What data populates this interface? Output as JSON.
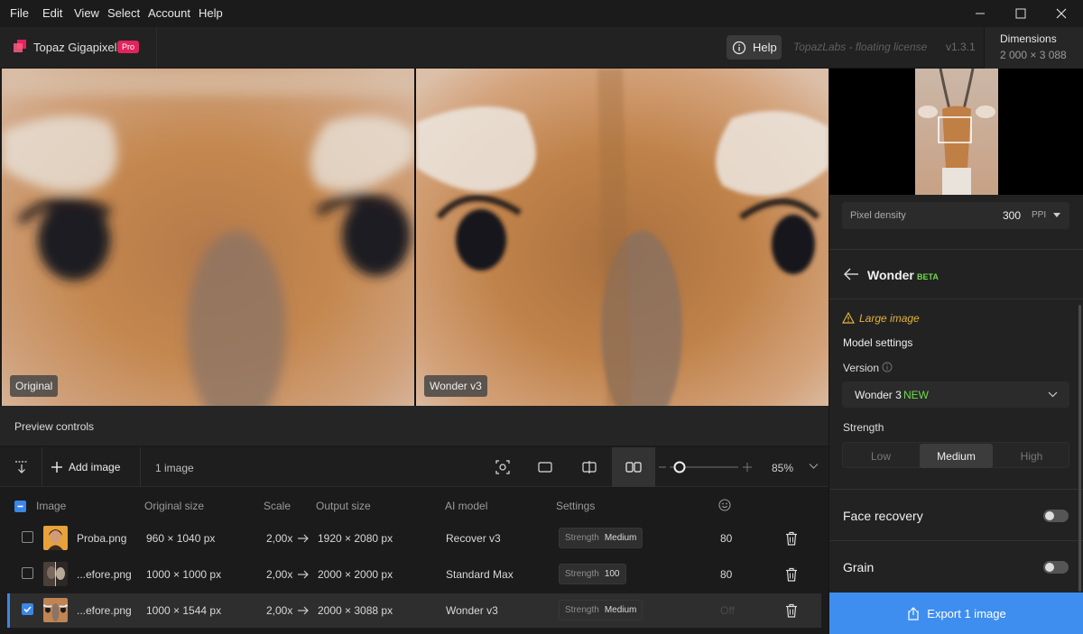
{
  "menu": [
    "File",
    "Edit",
    "View",
    "Select",
    "Account",
    "Help"
  ],
  "header": {
    "app_name": "Topaz Gigapixel",
    "badge": "Pro",
    "help_label": "Help",
    "license": "TopazLabs - floating license",
    "version": "v1.3.1",
    "dimensions_title": "Dimensions",
    "dimensions_value": "2 000 × 3 088"
  },
  "preview": {
    "left_label": "Original",
    "right_label": "Wonder v3",
    "controls_label": "Preview controls"
  },
  "toolbar": {
    "add_image": "Add image",
    "image_count": "1 image",
    "zoom": "85%"
  },
  "table": {
    "headers": {
      "image": "Image",
      "original_size": "Original size",
      "scale": "Scale",
      "output_size": "Output size",
      "ai_model": "AI model",
      "settings": "Settings"
    },
    "rows": [
      {
        "name": "Proba.png",
        "original": "960 × 1040 px",
        "scale": "2,00x",
        "output": "1920 × 2080 px",
        "model": "Recover v3",
        "setting_key": "Strength",
        "setting_val": "Medium",
        "score": "80",
        "checked": false
      },
      {
        "name": "...efore.png",
        "original": "1000 × 1000 px",
        "scale": "2,00x",
        "output": "2000 × 2000 px",
        "model": "Standard Max",
        "setting_key": "Strength",
        "setting_val": "100",
        "score": "80",
        "checked": false
      },
      {
        "name": "...efore.png",
        "original": "1000 × 1544 px",
        "scale": "2,00x",
        "output": "2000 × 3088 px",
        "model": "Wonder v3",
        "setting_key": "Strength",
        "setting_val": "Medium",
        "score": "Off",
        "checked": true
      }
    ]
  },
  "panel": {
    "pixel_density_label": "Pixel density",
    "pixel_density_value": "300",
    "pixel_density_unit": "PPI",
    "model_title": "Wonder",
    "model_badge": "BETA",
    "warning": "Large image",
    "model_settings": "Model settings",
    "version_label": "Version",
    "version_value": "Wonder 3",
    "version_badge": "NEW",
    "strength_label": "Strength",
    "strength_options": [
      "Low",
      "Medium",
      "High"
    ],
    "strength_selected": "Medium",
    "face_recovery": "Face recovery",
    "grain": "Grain",
    "export": "Export 1 image"
  },
  "colors": {
    "accent": "#3e8ef0",
    "beta": "#6ddc4a",
    "warning": "#e3b23c",
    "pro_badge": "#e0245e"
  }
}
